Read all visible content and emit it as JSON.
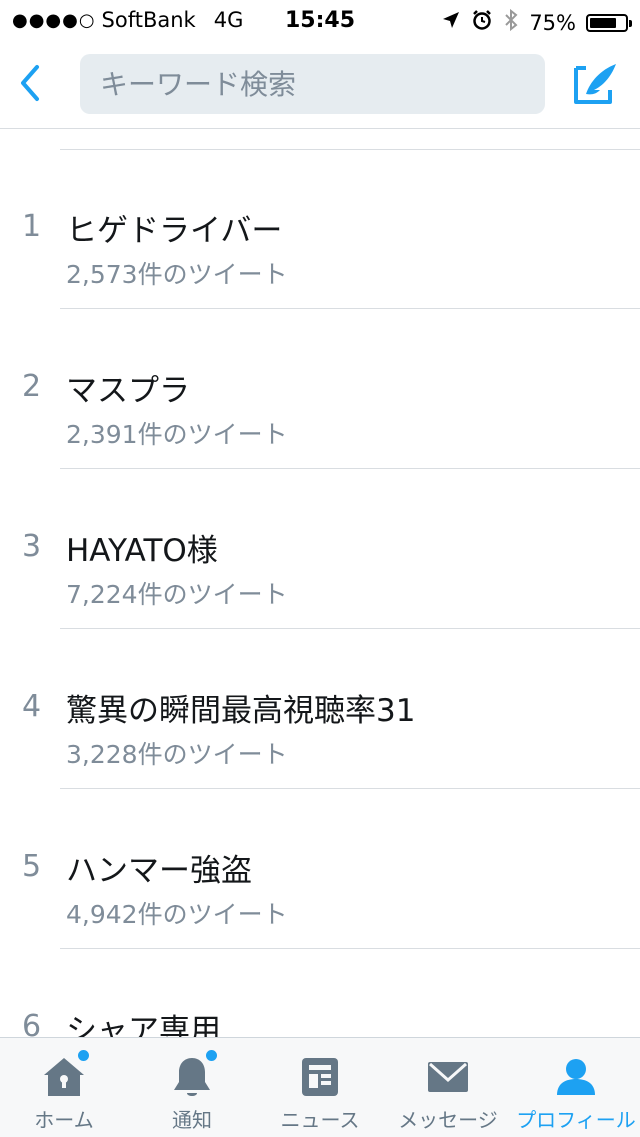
{
  "status_bar": {
    "signal": "●●●●○",
    "carrier": "SoftBank",
    "network": "4G",
    "time": "15:45",
    "battery": "75%",
    "battery_level": 0.75
  },
  "nav": {
    "search_placeholder": "キーワード検索"
  },
  "trends": [
    {
      "rank": "1",
      "name": "ヒゲドライバー",
      "count": "2,573件のツイート"
    },
    {
      "rank": "2",
      "name": "マスプラ",
      "count": "2,391件のツイート"
    },
    {
      "rank": "3",
      "name": "HAYATO様",
      "count": "7,224件のツイート"
    },
    {
      "rank": "4",
      "name": "驚異の瞬間最高視聴率31",
      "count": "3,228件のツイート"
    },
    {
      "rank": "5",
      "name": "ハンマー強盗",
      "count": "4,942件のツイート"
    },
    {
      "rank": "6",
      "name": "シャア専用",
      "count": ""
    }
  ],
  "tabs": [
    {
      "label": "ホーム",
      "icon": "home-icon",
      "badge": true
    },
    {
      "label": "通知",
      "icon": "bell-icon",
      "badge": true
    },
    {
      "label": "ニュース",
      "icon": "news-icon",
      "badge": false
    },
    {
      "label": "メッセージ",
      "icon": "envelope-icon",
      "badge": false
    },
    {
      "label": "プロフィール",
      "icon": "person-icon",
      "badge": false,
      "active": true
    }
  ],
  "colors": {
    "accent": "#1da1f2",
    "secondary_text": "#7f8c99",
    "tab_icon": "#657786"
  }
}
